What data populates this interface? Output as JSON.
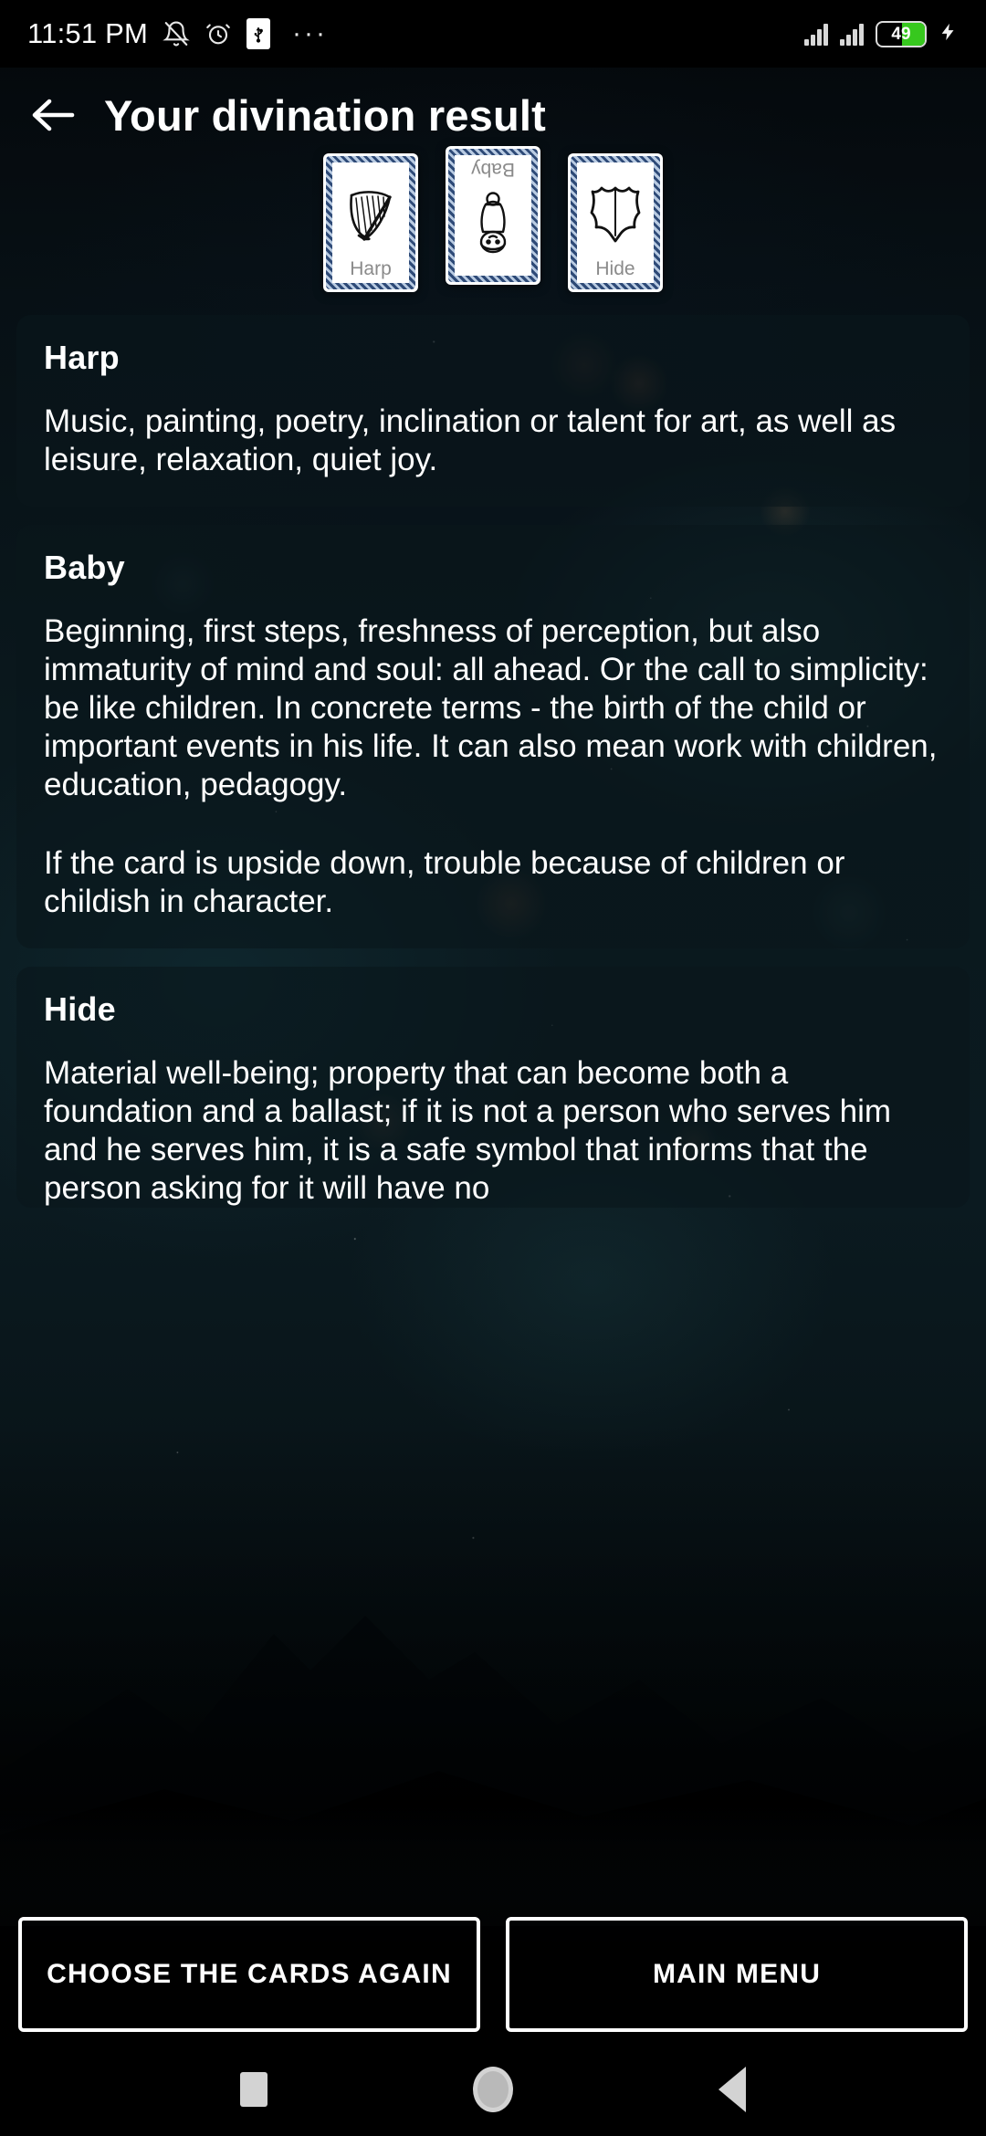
{
  "status_bar": {
    "time": "11:51 PM",
    "icons": [
      "mute-bell-icon",
      "alarm-clock-icon",
      "usb-icon",
      "overflow-dots-icon"
    ],
    "overflow": "···",
    "signal_bars": 2,
    "battery_percent": "49",
    "battery_level": 49,
    "charging": true,
    "charging_glyph": "⚡",
    "battery_color": "#37c81e"
  },
  "header": {
    "back_label": "←",
    "title": "Your divination result"
  },
  "cards": [
    {
      "name": "Harp",
      "label": "Harp",
      "art": "harp-icon",
      "flipped": false
    },
    {
      "name": "Baby",
      "label": "Baby",
      "art": "baby-icon",
      "flipped": true
    },
    {
      "name": "Hide",
      "label": "Hide",
      "art": "hide-icon",
      "flipped": false
    }
  ],
  "results": [
    {
      "title": "Harp",
      "paragraphs": [
        "Music, painting, poetry, inclination or talent for art, as well as leisure, relaxation, quiet joy."
      ]
    },
    {
      "title": "Baby",
      "paragraphs": [
        "Beginning, first steps, freshness of perception, but also immaturity of mind and soul: all ahead. Or the call to simplicity: be like children. In concrete terms - the birth of the child or important events in his life. It can also mean work with children, education, pedagogy.",
        "If the card is upside down, trouble because of children or childish in character."
      ]
    },
    {
      "title": "Hide",
      "paragraphs": [
        "Material well-being; property that can become both a foundation and a ballast; if it is not a person who serves him and he serves him, it is a safe symbol that informs that the person asking for it will have no"
      ]
    }
  ],
  "footer": {
    "choose_again_label": "CHOOSE THE CARDS AGAIN",
    "main_menu_label": "MAIN MENU"
  },
  "nav_bar": {
    "recent_label": "recent-apps-icon",
    "home_label": "home-icon",
    "back_label": "back-icon"
  },
  "colors": {
    "accent_green": "#37c81e",
    "card_border_blue": "#2e4a77",
    "card_label_gray": "#8a8a8a",
    "panel_bg": "rgba(9,22,28,0.62)",
    "text_white": "#ffffff"
  }
}
